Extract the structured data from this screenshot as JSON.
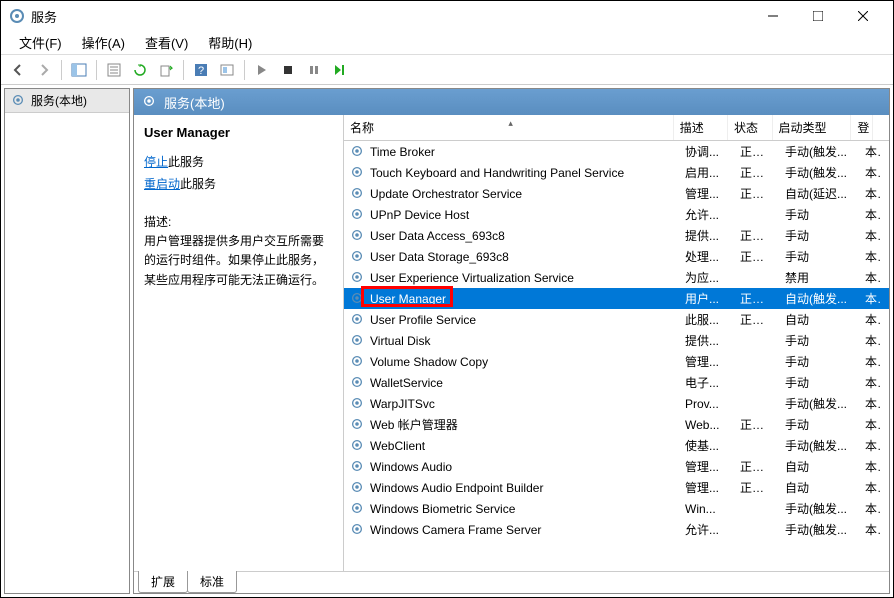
{
  "window": {
    "title": "服务"
  },
  "menu": {
    "file": "文件(F)",
    "operate": "操作(A)",
    "view": "查看(V)",
    "help": "帮助(H)"
  },
  "tree": {
    "local": "服务(本地)"
  },
  "pane_header": "服务(本地)",
  "detail": {
    "name": "User Manager",
    "stop_link": "停止",
    "stop_suffix": "此服务",
    "restart_link": "重启动",
    "restart_suffix": "此服务",
    "desc_label": "描述:",
    "desc_text": "用户管理器提供多用户交互所需要的运行时组件。如果停止此服务，某些应用程序可能无法正确运行。"
  },
  "columns": {
    "name": "名称",
    "desc": "描述",
    "status": "状态",
    "startup": "启动类型",
    "logon": "登"
  },
  "tabs": {
    "extended": "扩展",
    "standard": "标准"
  },
  "services": [
    {
      "name": "Time Broker",
      "desc": "协调...",
      "status": "正在...",
      "startup": "手动(触发...",
      "logon": "本"
    },
    {
      "name": "Touch Keyboard and Handwriting Panel Service",
      "desc": "启用...",
      "status": "正在...",
      "startup": "手动(触发...",
      "logon": "本"
    },
    {
      "name": "Update Orchestrator Service",
      "desc": "管理...",
      "status": "正在...",
      "startup": "自动(延迟...",
      "logon": "本"
    },
    {
      "name": "UPnP Device Host",
      "desc": "允许...",
      "status": "",
      "startup": "手动",
      "logon": "本"
    },
    {
      "name": "User Data Access_693c8",
      "desc": "提供...",
      "status": "正在...",
      "startup": "手动",
      "logon": "本"
    },
    {
      "name": "User Data Storage_693c8",
      "desc": "处理...",
      "status": "正在...",
      "startup": "手动",
      "logon": "本"
    },
    {
      "name": "User Experience Virtualization Service",
      "desc": "为应...",
      "status": "",
      "startup": "禁用",
      "logon": "本"
    },
    {
      "name": "User Manager",
      "desc": "用户...",
      "status": "正在...",
      "startup": "自动(触发...",
      "logon": "本",
      "selected": true
    },
    {
      "name": "User Profile Service",
      "desc": "此服...",
      "status": "正在...",
      "startup": "自动",
      "logon": "本"
    },
    {
      "name": "Virtual Disk",
      "desc": "提供...",
      "status": "",
      "startup": "手动",
      "logon": "本"
    },
    {
      "name": "Volume Shadow Copy",
      "desc": "管理...",
      "status": "",
      "startup": "手动",
      "logon": "本"
    },
    {
      "name": "WalletService",
      "desc": "电子...",
      "status": "",
      "startup": "手动",
      "logon": "本"
    },
    {
      "name": "WarpJITSvc",
      "desc": "Prov...",
      "status": "",
      "startup": "手动(触发...",
      "logon": "本"
    },
    {
      "name": "Web 帐户管理器",
      "desc": "Web...",
      "status": "正在...",
      "startup": "手动",
      "logon": "本"
    },
    {
      "name": "WebClient",
      "desc": "使基...",
      "status": "",
      "startup": "手动(触发...",
      "logon": "本"
    },
    {
      "name": "Windows Audio",
      "desc": "管理...",
      "status": "正在...",
      "startup": "自动",
      "logon": "本"
    },
    {
      "name": "Windows Audio Endpoint Builder",
      "desc": "管理...",
      "status": "正在...",
      "startup": "自动",
      "logon": "本"
    },
    {
      "name": "Windows Biometric Service",
      "desc": "Win...",
      "status": "",
      "startup": "手动(触发...",
      "logon": "本"
    },
    {
      "name": "Windows Camera Frame Server",
      "desc": "允许...",
      "status": "",
      "startup": "手动(触发...",
      "logon": "本"
    }
  ]
}
